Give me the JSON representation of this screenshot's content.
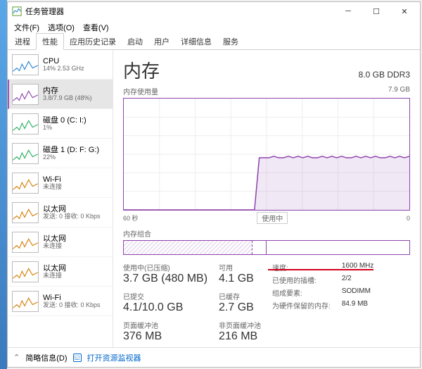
{
  "window": {
    "title": "任务管理器"
  },
  "menu": [
    "文件(F)",
    "选项(O)",
    "查看(V)"
  ],
  "tabs": [
    "进程",
    "性能",
    "应用历史记录",
    "启动",
    "用户",
    "详细信息",
    "服务"
  ],
  "active_tab_index": 1,
  "sidebar": {
    "items": [
      {
        "name": "CPU",
        "sub": "14% 2.53 GHz",
        "color": "#2a84d2"
      },
      {
        "name": "内存",
        "sub": "3.8/7.9 GB (48%)",
        "color": "#8e44ad"
      },
      {
        "name": "磁盘 0 (C: I:)",
        "sub": "1%",
        "color": "#27ae60"
      },
      {
        "name": "磁盘 1 (D: F: G:)",
        "sub": "22%",
        "color": "#27ae60"
      },
      {
        "name": "Wi-Fi",
        "sub": "未连接",
        "color": "#d67e0a"
      },
      {
        "name": "以太网",
        "sub": "发送: 0 接收: 0 Kbps",
        "color": "#d67e0a"
      },
      {
        "name": "以太网",
        "sub": "未连接",
        "color": "#d67e0a"
      },
      {
        "name": "以太网",
        "sub": "未连接",
        "color": "#d67e0a"
      },
      {
        "name": "Wi-Fi",
        "sub": "发送: 0 接收: 0 Kbps",
        "color": "#d67e0a"
      }
    ],
    "selected_index": 1
  },
  "main": {
    "title": "内存",
    "info": "8.0 GB DDR3",
    "chart_top_label": "内存使用量",
    "chart_top_right": "7.9 GB",
    "chart_bottom_left": "60 秒",
    "chart_bottom_right": "0",
    "usage_marker": "使用中",
    "composition_label": "内存组合",
    "stats_left": [
      {
        "label": "使用中(已压缩)",
        "value": "3.7 GB (480 MB)"
      },
      {
        "label": "已提交",
        "value": "4.1/10.0 GB"
      },
      {
        "label": "页面缓冲池",
        "value": "376 MB"
      }
    ],
    "stats_mid": [
      {
        "label": "可用",
        "value": "4.1 GB"
      },
      {
        "label": "已缓存",
        "value": "2.7 GB"
      },
      {
        "label": "非页面缓冲池",
        "value": "216 MB"
      }
    ],
    "stats_right": [
      {
        "k": "速度:",
        "v": "1600 MHz"
      },
      {
        "k": "已使用的插槽:",
        "v": "2/2"
      },
      {
        "k": "组成要素:",
        "v": "SODIMM"
      },
      {
        "k": "为硬件保留的内存:",
        "v": "84.9 MB"
      }
    ]
  },
  "footer": {
    "less": "简略信息(D)",
    "link": "打开资源监视器"
  },
  "chart_data": {
    "type": "area",
    "title": "内存使用量",
    "ylabel": "GB",
    "ylim": [
      0,
      7.9
    ],
    "xrange_seconds": [
      60,
      0
    ],
    "series": [
      {
        "name": "内存",
        "color": "#8e44ad",
        "values": [
          0,
          0,
          0,
          0,
          0,
          0,
          0,
          0,
          0,
          0,
          0,
          0,
          0,
          0,
          0,
          0,
          0,
          0,
          0,
          0,
          0,
          0,
          0,
          0,
          0,
          0,
          0,
          0,
          3.7,
          3.7,
          3.7,
          3.8,
          3.7,
          3.7,
          3.8,
          3.7,
          3.8,
          3.7,
          3.8,
          3.7,
          3.7,
          3.8,
          3.7,
          3.8,
          3.7,
          3.8,
          3.7,
          3.7,
          3.8,
          3.7,
          3.8,
          3.7,
          3.8,
          3.7,
          3.7,
          3.8,
          3.7,
          3.8,
          3.7,
          3.8
        ]
      }
    ]
  }
}
